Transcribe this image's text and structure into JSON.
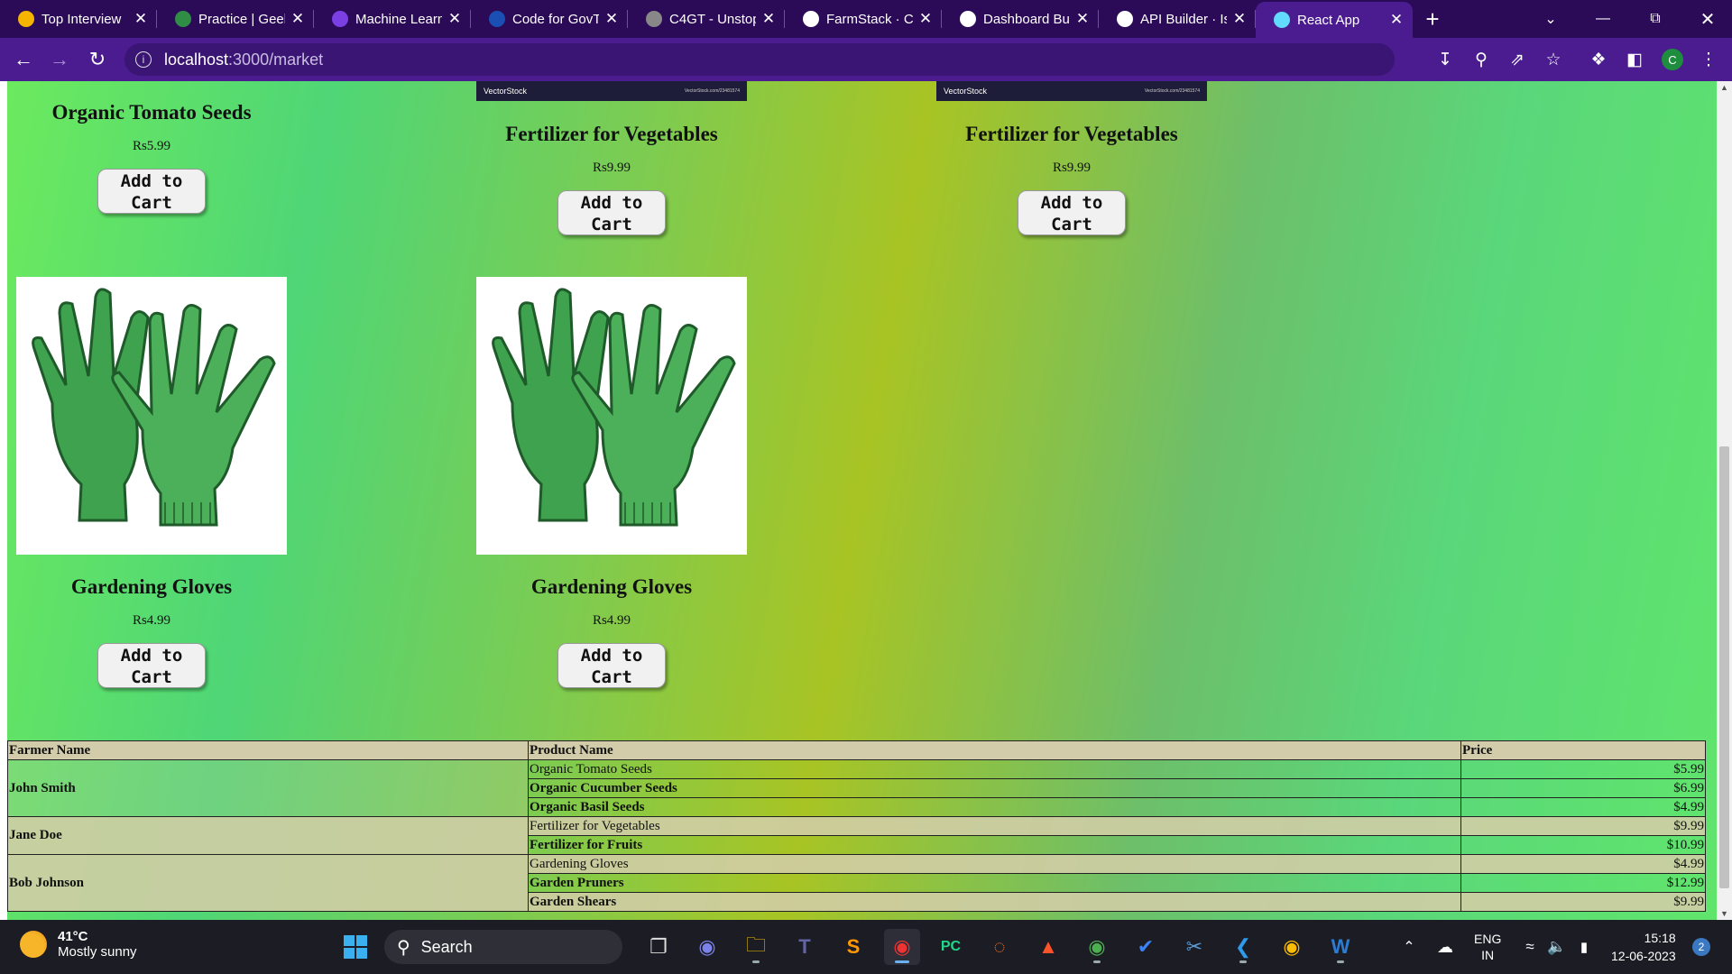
{
  "browser": {
    "tabs": [
      {
        "title": "Top Interview",
        "favicon": "interview-icon",
        "color": "#f5b400"
      },
      {
        "title": "Practice | Geel",
        "favicon": "gfg-icon",
        "color": "#2f8d46"
      },
      {
        "title": "Machine Learn",
        "favicon": "unstop-icon",
        "color": "#7b3fe4"
      },
      {
        "title": "Code for GovT",
        "favicon": "unstop-logo-icon",
        "color": "#1a4fb4"
      },
      {
        "title": "C4GT - Unstop",
        "favicon": "globe-icon",
        "color": "#888888"
      },
      {
        "title": "FarmStack · Cc",
        "favicon": "github-icon",
        "color": "#ffffff"
      },
      {
        "title": "Dashboard Bu",
        "favicon": "github-icon",
        "color": "#ffffff"
      },
      {
        "title": "API Builder · Is",
        "favicon": "github-icon",
        "color": "#ffffff"
      },
      {
        "title": "React App",
        "favicon": "react-icon",
        "color": "#61dafb"
      }
    ],
    "url_host": "localhost",
    "url_path": ":3000/market",
    "profile_initial": "C"
  },
  "products_top": [
    {
      "name": "Organic Tomato Seeds",
      "price": "Rs5.99",
      "button": "Add to Cart"
    },
    {
      "name": "Fertilizer for Vegetables",
      "price": "Rs9.99",
      "button": "Add to Cart",
      "watermark": "VectorStock",
      "watermark_url": "VectorStock.com/23481574"
    },
    {
      "name": "Fertilizer for Vegetables",
      "price": "Rs9.99",
      "button": "Add to Cart",
      "watermark": "VectorStock",
      "watermark_url": "VectorStock.com/23481574"
    }
  ],
  "products_bottom": [
    {
      "name": "Gardening Gloves",
      "price": "Rs4.99",
      "button": "Add to Cart"
    },
    {
      "name": "Gardening Gloves",
      "price": "Rs4.99",
      "button": "Add to Cart"
    }
  ],
  "table": {
    "headers": [
      "Farmer Name",
      "Product Name",
      "Price"
    ],
    "rows": [
      {
        "farmer": "John Smith",
        "products": [
          {
            "name": "Organic Tomato Seeds",
            "price": "$5.99"
          },
          {
            "name": "Organic Cucumber Seeds",
            "price": "$6.99"
          },
          {
            "name": "Organic Basil Seeds",
            "price": "$4.99"
          }
        ]
      },
      {
        "farmer": "Jane Doe",
        "products": [
          {
            "name": "Fertilizer for Vegetables",
            "price": "$9.99"
          },
          {
            "name": "Fertilizer for Fruits",
            "price": "$10.99"
          }
        ]
      },
      {
        "farmer": "Bob Johnson",
        "products": [
          {
            "name": "Gardening Gloves",
            "price": "$4.99"
          },
          {
            "name": "Garden Pruners",
            "price": "$12.99"
          },
          {
            "name": "Garden Shears",
            "price": "$9.99"
          }
        ]
      }
    ]
  },
  "taskbar": {
    "temperature": "41°C",
    "weather": "Mostly sunny",
    "search_label": "Search",
    "lang1": "ENG",
    "lang2": "IN",
    "time": "15:18",
    "date": "12-06-2023",
    "notification_count": "2"
  }
}
